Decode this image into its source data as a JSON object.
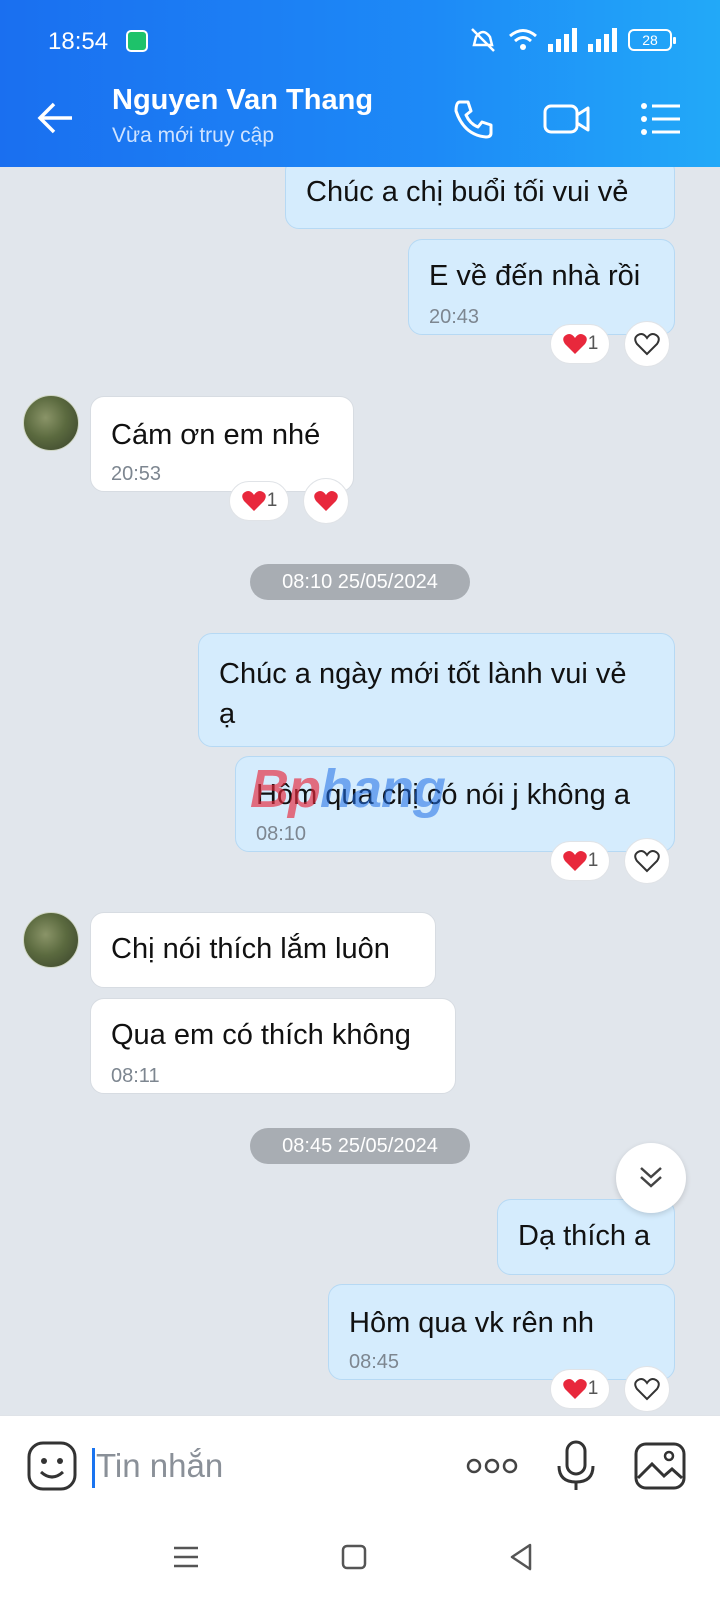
{
  "status_bar": {
    "time": "18:54",
    "battery": "28"
  },
  "header": {
    "contact_name": "Nguyen Van Thang",
    "status": "Vừa mới truy cập"
  },
  "messages": [
    {
      "text": "Chúc a chị buổi tối vui vẻ"
    },
    {
      "text": "E về đến nhà rồi",
      "time": "20:43",
      "reaction_count": "1"
    },
    {
      "text": "Cám ơn em nhé",
      "time": "20:53",
      "reaction_count": "1"
    },
    {
      "text": "Chúc a ngày mới tốt lành vui vẻ ạ"
    },
    {
      "text": "Hôm qua chị có nói j không a",
      "time": "08:10",
      "reaction_count": "1"
    },
    {
      "text": "Chị nói thích lắm luôn"
    },
    {
      "text": "Qua em có thích không",
      "time": "08:11"
    },
    {
      "text": "Dạ thích a"
    },
    {
      "text": "Hôm qua vk rên nh",
      "time": "08:45",
      "reaction_count": "1"
    }
  ],
  "date_separators": [
    "08:10 25/05/2024",
    "08:45 25/05/2024"
  ],
  "watermark": {
    "part1": "Bp",
    "part2": "hang"
  },
  "composer": {
    "placeholder": "Tin nhắn"
  },
  "icons": {
    "back": "arrow-left-icon",
    "call": "phone-icon",
    "video": "video-camera-icon",
    "menu": "list-icon",
    "emoji": "emoji-icon",
    "more": "more-dots-icon",
    "mic": "microphone-icon",
    "gallery": "image-icon",
    "scroll": "chevron-double-down-icon",
    "heart": "heart-icon"
  },
  "colors": {
    "header_start": "#1a6ff0",
    "header_end": "#22a9f8",
    "outgoing_bubble": "#d5ecfd",
    "incoming_bubble": "#ffffff",
    "heart": "#e8283c"
  }
}
